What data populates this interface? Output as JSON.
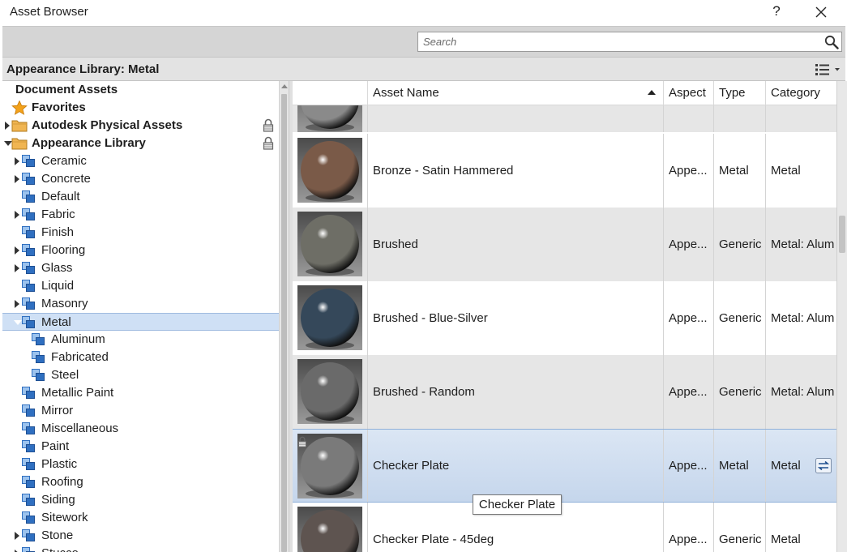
{
  "window": {
    "title": "Asset Browser",
    "help_label": "?"
  },
  "search": {
    "placeholder": "Search"
  },
  "library": {
    "title": "Appearance Library: Metal"
  },
  "tree": [
    {
      "label": "Document Assets",
      "bold": true,
      "indent": 0,
      "arrow": "none",
      "icon": "none"
    },
    {
      "label": "Favorites",
      "bold": true,
      "indent": 0,
      "arrow": "none",
      "icon": "star"
    },
    {
      "label": "Autodesk Physical Assets",
      "bold": true,
      "indent": 0,
      "arrow": "right",
      "icon": "folder",
      "locked": true
    },
    {
      "label": "Appearance Library",
      "bold": true,
      "indent": 0,
      "arrow": "down",
      "icon": "folder",
      "locked": true
    },
    {
      "label": "Ceramic",
      "indent": 1,
      "arrow": "right",
      "icon": "category"
    },
    {
      "label": "Concrete",
      "indent": 1,
      "arrow": "right",
      "icon": "category"
    },
    {
      "label": "Default",
      "indent": 1,
      "arrow": "none",
      "icon": "category"
    },
    {
      "label": "Fabric",
      "indent": 1,
      "arrow": "right",
      "icon": "category"
    },
    {
      "label": "Finish",
      "indent": 1,
      "arrow": "none",
      "icon": "category"
    },
    {
      "label": "Flooring",
      "indent": 1,
      "arrow": "right",
      "icon": "category"
    },
    {
      "label": "Glass",
      "indent": 1,
      "arrow": "right",
      "icon": "category"
    },
    {
      "label": "Liquid",
      "indent": 1,
      "arrow": "none",
      "icon": "category"
    },
    {
      "label": "Masonry",
      "indent": 1,
      "arrow": "right",
      "icon": "category"
    },
    {
      "label": "Metal",
      "indent": 1,
      "arrow": "down",
      "icon": "category",
      "selected": true
    },
    {
      "label": "Aluminum",
      "indent": 2,
      "arrow": "none",
      "icon": "category"
    },
    {
      "label": "Fabricated",
      "indent": 2,
      "arrow": "none",
      "icon": "category"
    },
    {
      "label": "Steel",
      "indent": 2,
      "arrow": "none",
      "icon": "category"
    },
    {
      "label": "Metallic Paint",
      "indent": 1,
      "arrow": "none",
      "icon": "category"
    },
    {
      "label": "Mirror",
      "indent": 1,
      "arrow": "none",
      "icon": "category"
    },
    {
      "label": "Miscellaneous",
      "indent": 1,
      "arrow": "none",
      "icon": "category"
    },
    {
      "label": "Paint",
      "indent": 1,
      "arrow": "none",
      "icon": "category"
    },
    {
      "label": "Plastic",
      "indent": 1,
      "arrow": "none",
      "icon": "category"
    },
    {
      "label": "Roofing",
      "indent": 1,
      "arrow": "none",
      "icon": "category"
    },
    {
      "label": "Siding",
      "indent": 1,
      "arrow": "none",
      "icon": "category"
    },
    {
      "label": "Sitework",
      "indent": 1,
      "arrow": "none",
      "icon": "category"
    },
    {
      "label": "Stone",
      "indent": 1,
      "arrow": "right",
      "icon": "category"
    },
    {
      "label": "Stucco",
      "indent": 1,
      "arrow": "right",
      "icon": "category"
    }
  ],
  "table": {
    "columns": {
      "thumb": "",
      "name": "Asset Name",
      "aspect": "Aspect",
      "type": "Type",
      "category": "Category"
    },
    "rows": [
      {
        "name": "",
        "aspect": "",
        "type": "",
        "category": "",
        "shade": "grey",
        "sphere": "#8a8a8a",
        "locked": false,
        "partial": true
      },
      {
        "name": "Bronze - Satin Hammered",
        "aspect": "Appe...",
        "type": "Metal",
        "category": "Metal",
        "shade": "white",
        "sphere": "#7a5a48",
        "locked": false
      },
      {
        "name": "Brushed",
        "aspect": "Appe...",
        "type": "Generic",
        "category": "Metal: Alum",
        "shade": "grey",
        "sphere": "#6e6e66",
        "locked": false
      },
      {
        "name": "Brushed - Blue-Silver",
        "aspect": "Appe...",
        "type": "Generic",
        "category": "Metal: Alum",
        "shade": "white",
        "sphere": "#35485a",
        "locked": false
      },
      {
        "name": "Brushed - Random",
        "aspect": "Appe...",
        "type": "Generic",
        "category": "Metal: Alum",
        "shade": "grey",
        "sphere": "#6a6a6a",
        "locked": false
      },
      {
        "name": "Checker Plate",
        "aspect": "Appe...",
        "type": "Metal",
        "category": "Metal",
        "shade": "selected",
        "sphere": "#7a7a7a",
        "locked": true,
        "replace": true
      },
      {
        "name": "Checker Plate - 45deg",
        "aspect": "Appe...",
        "type": "Generic",
        "category": "Metal",
        "shade": "white",
        "sphere": "#5e5450",
        "locked": false
      }
    ]
  },
  "tooltip": {
    "text": "Checker Plate"
  },
  "colors": {
    "selection": "#cfe0f5",
    "folder": "#f0b552",
    "category_icon": "#2f6fc0",
    "star": "#f3a21b"
  }
}
